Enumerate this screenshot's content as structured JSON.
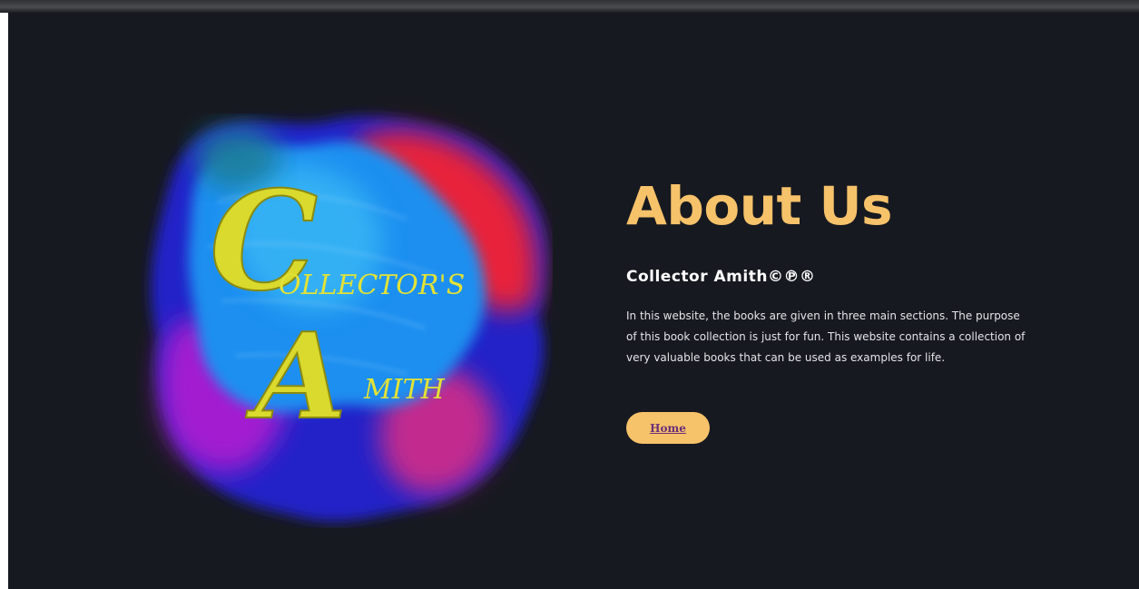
{
  "logo": {
    "big_initial_1": "C",
    "word_1": "OLLECTOR'S",
    "big_initial_2": "A",
    "word_2": "MITH",
    "colors": {
      "splash_blue": "#1d8ff0",
      "splash_deep_blue": "#2a2ad8",
      "splash_red": "#e8233b",
      "splash_purple": "#9a1fc8",
      "splash_magenta": "#c22a8e",
      "lettering": "#e2e236"
    }
  },
  "about": {
    "heading": "About Us",
    "subheading": "Collector Amith©℗®",
    "description": "In this website, the books are given in three main sections. The purpose of this book collection is just for fun. This website contains a collection of very valuable books that can be used as examples for life.",
    "home_button": "Home"
  },
  "theme": {
    "background": "#171920",
    "accent": "#f6c26a",
    "button_text": "#6a2f7a"
  }
}
